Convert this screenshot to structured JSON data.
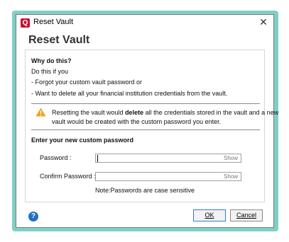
{
  "window": {
    "app_icon_letter": "Q",
    "title": "Reset Vault",
    "close_glyph": "✕"
  },
  "main": {
    "heading": "Reset Vault"
  },
  "why": {
    "heading": "Why do this?",
    "intro": "Do this if you",
    "bullets": [
      "- Forgot your custom vault password or",
      "- Want to delete all your financial institution credentials from the vault."
    ]
  },
  "warning": {
    "icon": "warning-icon",
    "line1_pre": "Resetting the vault would ",
    "line1_bold": "delete",
    "line1_post": " all the credentials stored in the vault and a new",
    "line2": "vault would be created with the custom password you enter."
  },
  "form": {
    "heading": "Enter your new custom password",
    "password_label": "Password :",
    "confirm_label": "Confirm Password :",
    "show_label": "Show",
    "password_value": "",
    "confirm_value": "",
    "note": "Note:Passwords are case sensitive"
  },
  "footer": {
    "help_glyph": "?",
    "ok_label": "OK",
    "cancel_label": "Cancel"
  },
  "colors": {
    "frame": "#7fd0c4",
    "app_icon": "#c8102e",
    "warning": "#f0a020",
    "help": "#1f6fc6",
    "ok_border": "#2e7bd6"
  }
}
